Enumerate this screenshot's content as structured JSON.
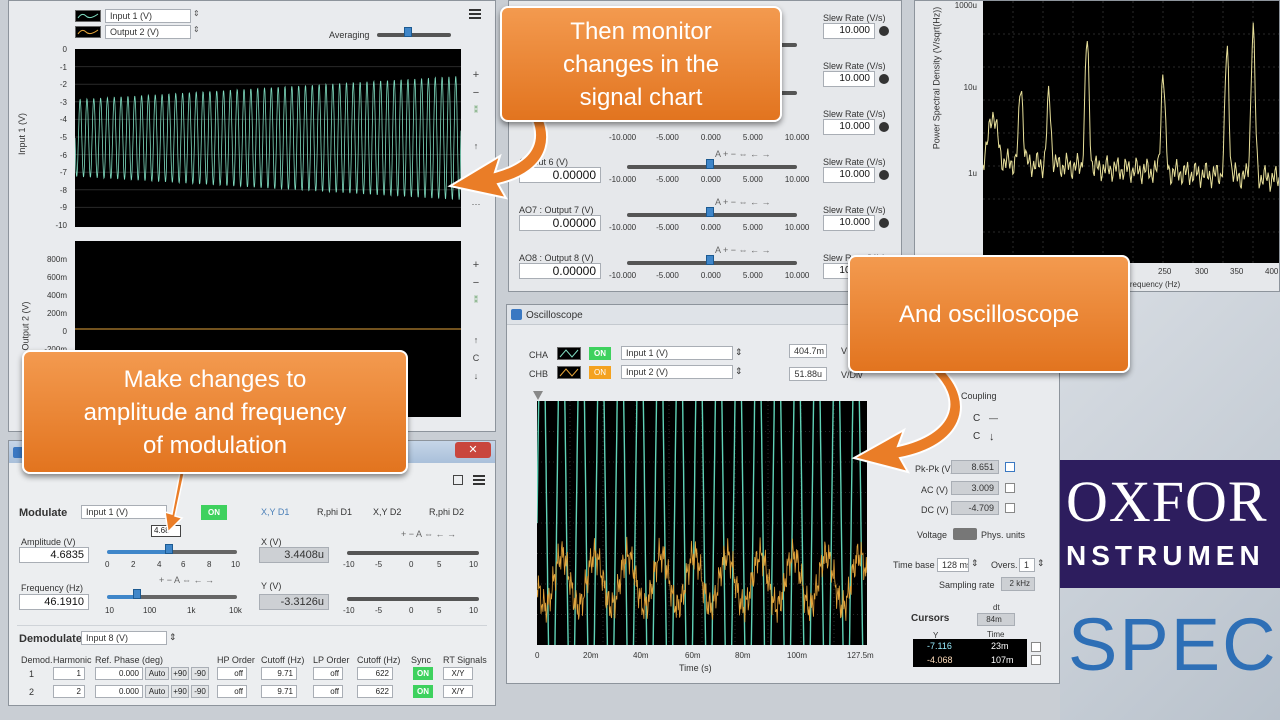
{
  "top_left": {
    "ch1": "Input 1 (V)",
    "ch2": "Output 2 (V)",
    "averaging": "Averaging",
    "y1_label": "Input 1 (V)",
    "y2_label": "Output 2 (V)",
    "y1_ticks": [
      "0",
      "-1",
      "-2",
      "-3",
      "-4",
      "-5",
      "-6",
      "-7",
      "-8",
      "-9",
      "-10"
    ],
    "y2_ticks": [
      "800m",
      "600m",
      "400m",
      "200m",
      "0",
      "-200m"
    ],
    "tool_plus": "+",
    "tool_minus": "−",
    "tool_up": "↑",
    "tool_c": "C",
    "tool_down": "↓",
    "tool_more": "···"
  },
  "ao_panel": {
    "slew_label": "Slew Rate (V/s)",
    "slew_values": [
      "10.000",
      "10.000",
      "10.000",
      "10.000",
      "10.000",
      "10.000"
    ],
    "outputs": [
      {
        "label": "Output 6 (V)",
        "value": "0.00000"
      },
      {
        "label": "AO7 : Output 7 (V)",
        "value": "0.00000"
      },
      {
        "label": "AO8 : Output 8 (V)",
        "value": "0.00000"
      }
    ],
    "scale": [
      "-10.000",
      "-5.000",
      "0.000",
      "5.000",
      "10.000"
    ],
    "slider_tools": "A + − ⇔ ← →"
  },
  "spectrum": {
    "ylabel": "Power Spectral Density (V/sqrt(Hz))",
    "yticks": [
      "1000u",
      "10u",
      "1u"
    ],
    "xticks": [
      "250",
      "300",
      "350",
      "400"
    ],
    "xlabel": "Frequency (Hz)"
  },
  "modulation": {
    "modulate_label": "Modulate",
    "modulate_input": "Input 1 (V)",
    "on": "ON",
    "amp_label": "Amplitude (V)",
    "amp_value": "4.6835",
    "amp_tooltip": "4.68",
    "amp_scale": [
      "0",
      "2",
      "4",
      "6",
      "8",
      "10"
    ],
    "freq_label": "Frequency (Hz)",
    "freq_value": "46.1910",
    "freq_scale": [
      "10",
      "100",
      "1k",
      "10k"
    ],
    "xy_d1": "X,Y  D1",
    "rphi_d1": "R,phi  D1",
    "xy_d2": "X,Y  D2",
    "rphi_d2": "R,phi  D2",
    "x_label": "X (V)",
    "x_value": "3.4408u",
    "y_label": "Y (V)",
    "y_value": "-3.3126u",
    "xy_scale": [
      "-10",
      "-5",
      "0",
      "5",
      "10"
    ],
    "slider_tools": "+ − A ⇔ ← →",
    "demod_label": "Demodulate",
    "demod_input": "Input 8 (V)",
    "headers": [
      "Demod.",
      "Harmonic",
      "Ref. Phase (deg)",
      "HP Order",
      "Cutoff (Hz)",
      "LP Order",
      "Cutoff (Hz)",
      "Sync",
      "RT Signals"
    ],
    "rows": [
      {
        "demod": "1",
        "harmonic": "1",
        "phase": "0.000",
        "hp": "off",
        "hpcut": "9.71",
        "lp": "off",
        "lpcut": "622",
        "sync": "ON",
        "rt": "X/Y"
      },
      {
        "demod": "2",
        "harmonic": "2",
        "phase": "0.000",
        "hp": "off",
        "hpcut": "9.71",
        "lp": "off",
        "lpcut": "622",
        "sync": "ON",
        "rt": "X/Y"
      }
    ],
    "auto": "Auto",
    "p90": "+90",
    "m90": "-90",
    "close": "✕"
  },
  "oscilloscope": {
    "title": "Oscilloscope",
    "cha": "CHA",
    "chb": "CHB",
    "on": "ON",
    "cha_input": "Input 1 (V)",
    "chb_input": "Input 2 (V)",
    "scale_a": "404.7m",
    "scale_b": "51.88u",
    "v_unit": "V",
    "vdiv_unit": "V/Div",
    "coupling": "Coupling",
    "ac_c": "C",
    "dc_c": "C",
    "dash": "—",
    "arrow": "↓",
    "pk_label": "Pk-Pk (V)",
    "pk_value": "8.651",
    "ac_label": "AC (V)",
    "ac_value": "3.009",
    "dc_label": "DC (V)",
    "dc_value": "-4.709",
    "voltage": "Voltage",
    "phys": "Phys. units",
    "timebase_label": "Time base",
    "timebase": "128 ms",
    "overs_label": "Overs.",
    "overs": "1",
    "sampling_label": "Sampling rate",
    "sampling": "2 kHz",
    "cursors": "Cursors",
    "dt_label": "dt",
    "dt": "84m",
    "y_head": "Y",
    "time_head": "Time",
    "cur1_y": "-7.116",
    "cur1_t": "23m",
    "cur2_y": "-4.068",
    "cur2_t": "107m",
    "xticks": [
      "0",
      "20m",
      "40m",
      "60m",
      "80m",
      "100m",
      "127.5m"
    ],
    "xlabel": "Time (s)"
  },
  "brand": {
    "oxford_line1": "OXFOR",
    "oxford_line2": "NSTRUMEN",
    "spec": "SPEC"
  },
  "callouts": {
    "monitor": "Then monitor\nchanges in the\nsignal chart",
    "osc": "And oscilloscope",
    "mod": "Make changes to\namplitude and frequency\nof modulation"
  }
}
